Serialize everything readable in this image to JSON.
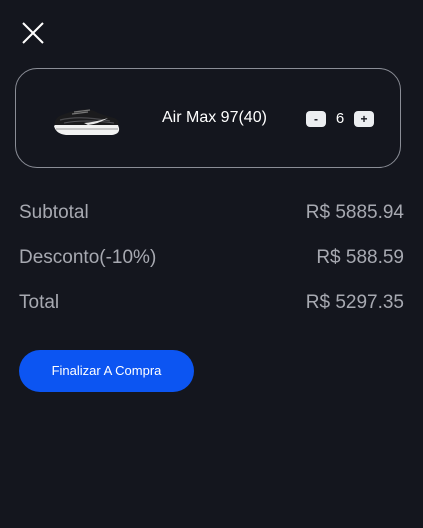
{
  "cart": {
    "items": [
      {
        "name": "Air Max 97(40)",
        "quantity": "6",
        "decrement_label": "-",
        "increment_label": "+",
        "image_icon": "sneaker-icon"
      }
    ]
  },
  "summary": {
    "subtotal_label": "Subtotal",
    "subtotal_value": "R$ 5885.94",
    "discount_label": "Desconto(-10%)",
    "discount_value": "R$ 588.59",
    "total_label": "Total",
    "total_value": "R$ 5297.35"
  },
  "actions": {
    "checkout_label": "Finalizar A Compra",
    "close_icon": "close-icon"
  },
  "colors": {
    "background": "#14161e",
    "accent": "#0c55f2",
    "muted_text": "#a7a9b1",
    "border": "#8a8d96"
  }
}
